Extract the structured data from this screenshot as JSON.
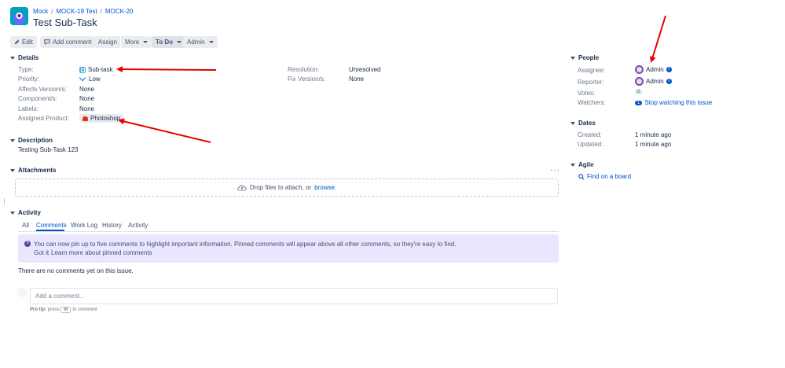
{
  "breadcrumb": {
    "project": "Mock",
    "parent": "MOCK-19 Test",
    "issue": "MOCK-20"
  },
  "issue_title": "Test Sub-Task",
  "toolbar": {
    "edit": "Edit",
    "add_comment": "Add comment",
    "assign": "Assign",
    "more": "More",
    "status": "To Do",
    "admin": "Admin"
  },
  "details": {
    "heading": "Details",
    "type_label": "Type:",
    "type_value": "Sub-task",
    "priority_label": "Priority:",
    "priority_value": "Low",
    "affects_label": "Affects Version/s:",
    "affects_value": "None",
    "component_label": "Component/s:",
    "component_value": "None",
    "labels_label": "Labels:",
    "labels_value": "None",
    "product_label": "Assigned Product:",
    "product_value": "Photoshop",
    "resolution_label": "Resolution:",
    "resolution_value": "Unresolved",
    "fix_label": "Fix Version/s:",
    "fix_value": "None"
  },
  "description": {
    "heading": "Description",
    "text": "Testing Sub-Task 123"
  },
  "attachments": {
    "heading": "Attachments",
    "drop_text": "Drop files to attach, or",
    "browse": "browse."
  },
  "activity": {
    "heading": "Activity",
    "tabs": [
      "All",
      "Comments",
      "Work Log",
      "History",
      "Activity"
    ],
    "active_tab": "Comments",
    "pinned_info": "You can now pin up to five comments to highlight important information. Pinned comments will appear above all other comments, so they're easy to find.",
    "got_it": "Got it",
    "learn_more": "Learn more about pinned comments",
    "no_comments": "There are no comments yet on this issue.",
    "comment_placeholder": "Add a comment...",
    "pro_tip_label": "Pro tip:",
    "pro_tip_press": "press",
    "pro_tip_key": "m",
    "pro_tip_suffix": "to comment"
  },
  "people": {
    "heading": "People",
    "assignee_label": "Assignee:",
    "assignee": "Admin",
    "reporter_label": "Reporter:",
    "reporter": "Admin",
    "votes_label": "Votes:",
    "votes": "0",
    "watchers_label": "Watchers:",
    "watchers_count": "1",
    "watch_link": "Stop watching this issue"
  },
  "dates": {
    "heading": "Dates",
    "created_label": "Created:",
    "created": "1 minute ago",
    "updated_label": "Updated:",
    "updated": "1 minute ago"
  },
  "agile": {
    "heading": "Agile",
    "find_board": "Find on a board"
  },
  "colors": {
    "link": "#0052cc",
    "annotation_arrow": "#e60000",
    "info_bg": "#eae6ff"
  }
}
